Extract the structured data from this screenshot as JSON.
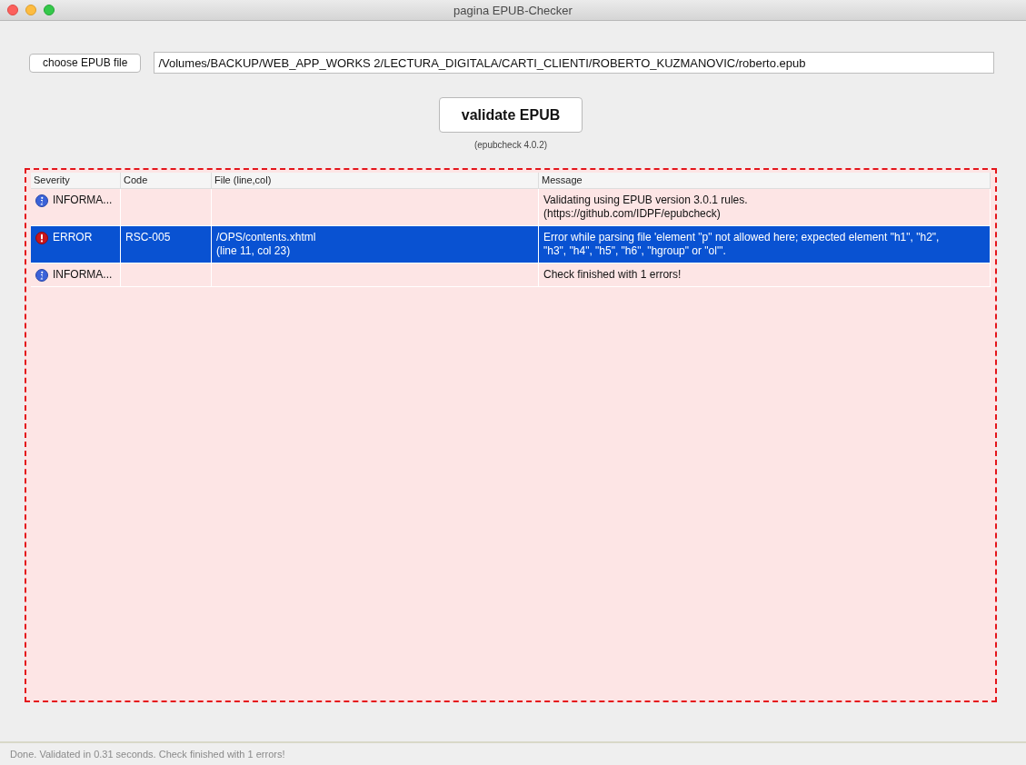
{
  "window": {
    "title": "pagina EPUB-Checker"
  },
  "choose_button": "choose EPUB file",
  "file_path": "/Volumes/BACKUP/WEB_APP_WORKS 2/LECTURA_DIGITALA/CARTI_CLIENTI/ROBERTO_KUZMANOVIC/roberto.epub",
  "validate_button": "validate EPUB",
  "version": "(epubcheck 4.0.2)",
  "table": {
    "columns": [
      "Severity",
      "Code",
      "File (line,col)",
      "Message"
    ],
    "rows": [
      {
        "kind": "info",
        "severity": "INFORMA...",
        "code": "",
        "file": [],
        "message": [
          "Validating using EPUB version 3.0.1 rules.",
          "(https://github.com/IDPF/epubcheck)"
        ],
        "selected": false
      },
      {
        "kind": "error",
        "severity": "ERROR",
        "code": "RSC-005",
        "file": [
          "/OPS/contents.xhtml",
          "(line 11, col 23)"
        ],
        "message": [
          "Error while parsing file 'element \"p\" not allowed here; expected element \"h1\", \"h2\",",
          "\"h3\", \"h4\", \"h5\", \"h6\", \"hgroup\" or \"ol\"'."
        ],
        "selected": true
      },
      {
        "kind": "info",
        "severity": "INFORMA...",
        "code": "",
        "file": [],
        "message": [
          "Check finished with 1 errors!"
        ],
        "selected": false
      }
    ]
  },
  "status_bar": "Done. Validated in 0.31 seconds. Check finished with 1 errors!"
}
